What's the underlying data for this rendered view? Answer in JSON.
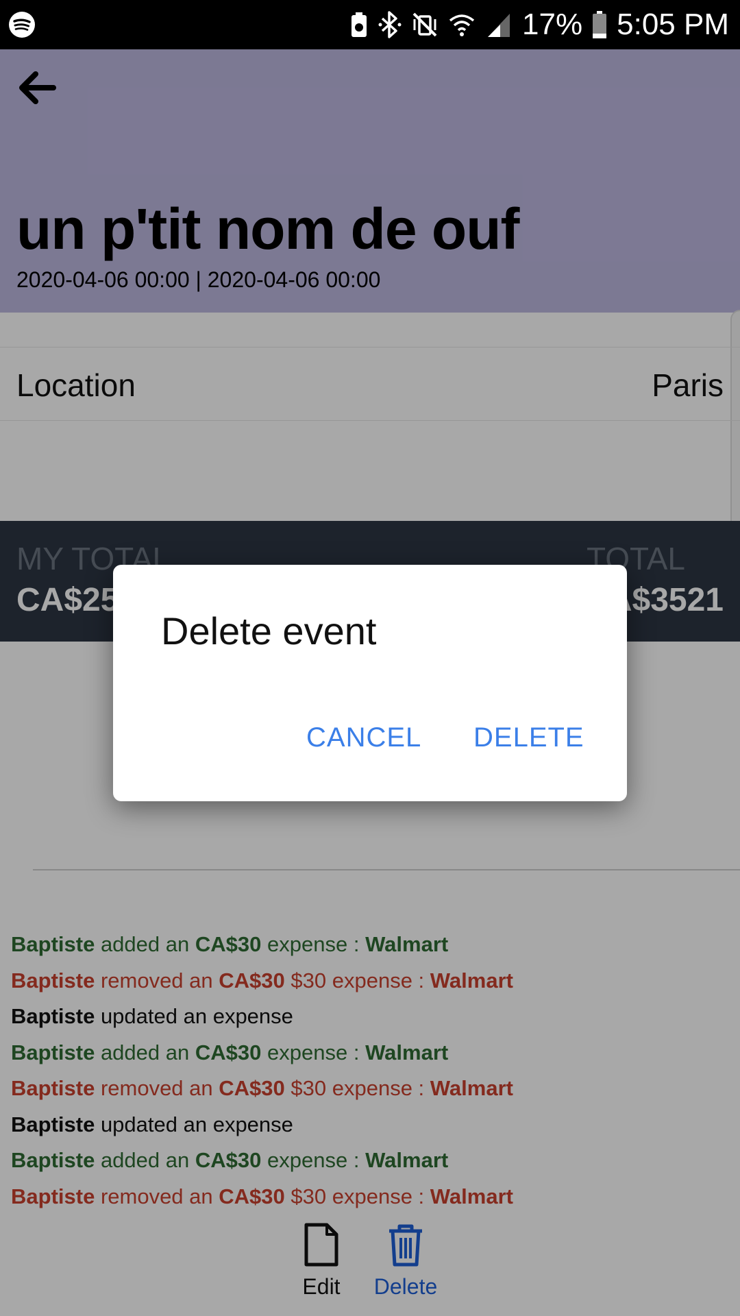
{
  "status_bar": {
    "battery_percent": "17%",
    "time": "5:05 PM"
  },
  "header": {
    "title": "un p'tit nom de ouf",
    "dates": "2020-04-06 00:00 | 2020-04-06 00:00",
    "bg_color": "#bdb8e0"
  },
  "info": {
    "label": "Location",
    "value": "Paris"
  },
  "totals": {
    "my_total_label": "MY TOTAL",
    "my_total_value": "CA$25",
    "total_label": "TOTAL",
    "total_value": "CA$3521"
  },
  "history": [
    {
      "type": "added",
      "user": "Baptiste",
      "mid": "added an",
      "amount": "CA$30",
      "rest": "expense :",
      "name": "Walmart"
    },
    {
      "type": "removed",
      "user": "Baptiste",
      "mid": "removed an",
      "amount": "CA$30",
      "rest": "$30 expense :",
      "name": "Walmart"
    },
    {
      "type": "updated",
      "user": "Baptiste",
      "mid": "updated an expense",
      "amount": "",
      "rest": "",
      "name": ""
    },
    {
      "type": "added",
      "user": "Baptiste",
      "mid": "added an",
      "amount": "CA$30",
      "rest": "expense :",
      "name": "Walmart"
    },
    {
      "type": "removed",
      "user": "Baptiste",
      "mid": "removed an",
      "amount": "CA$30",
      "rest": "$30 expense :",
      "name": "Walmart"
    },
    {
      "type": "updated",
      "user": "Baptiste",
      "mid": "updated an expense",
      "amount": "",
      "rest": "",
      "name": ""
    },
    {
      "type": "added",
      "user": "Baptiste",
      "mid": "added an",
      "amount": "CA$30",
      "rest": "expense :",
      "name": "Walmart"
    },
    {
      "type": "removed",
      "user": "Baptiste",
      "mid": "removed an",
      "amount": "CA$30",
      "rest": "$30 expense :",
      "name": "Walmart"
    }
  ],
  "actions": {
    "edit_label": "Edit",
    "delete_label": "Delete"
  },
  "dialog": {
    "title": "Delete event",
    "cancel_label": "CANCEL",
    "delete_label": "DELETE"
  },
  "colors": {
    "added": "#2e6b33",
    "removed": "#c9402e",
    "accent": "#3b7fe8",
    "totals_bg": "#2c3643"
  }
}
